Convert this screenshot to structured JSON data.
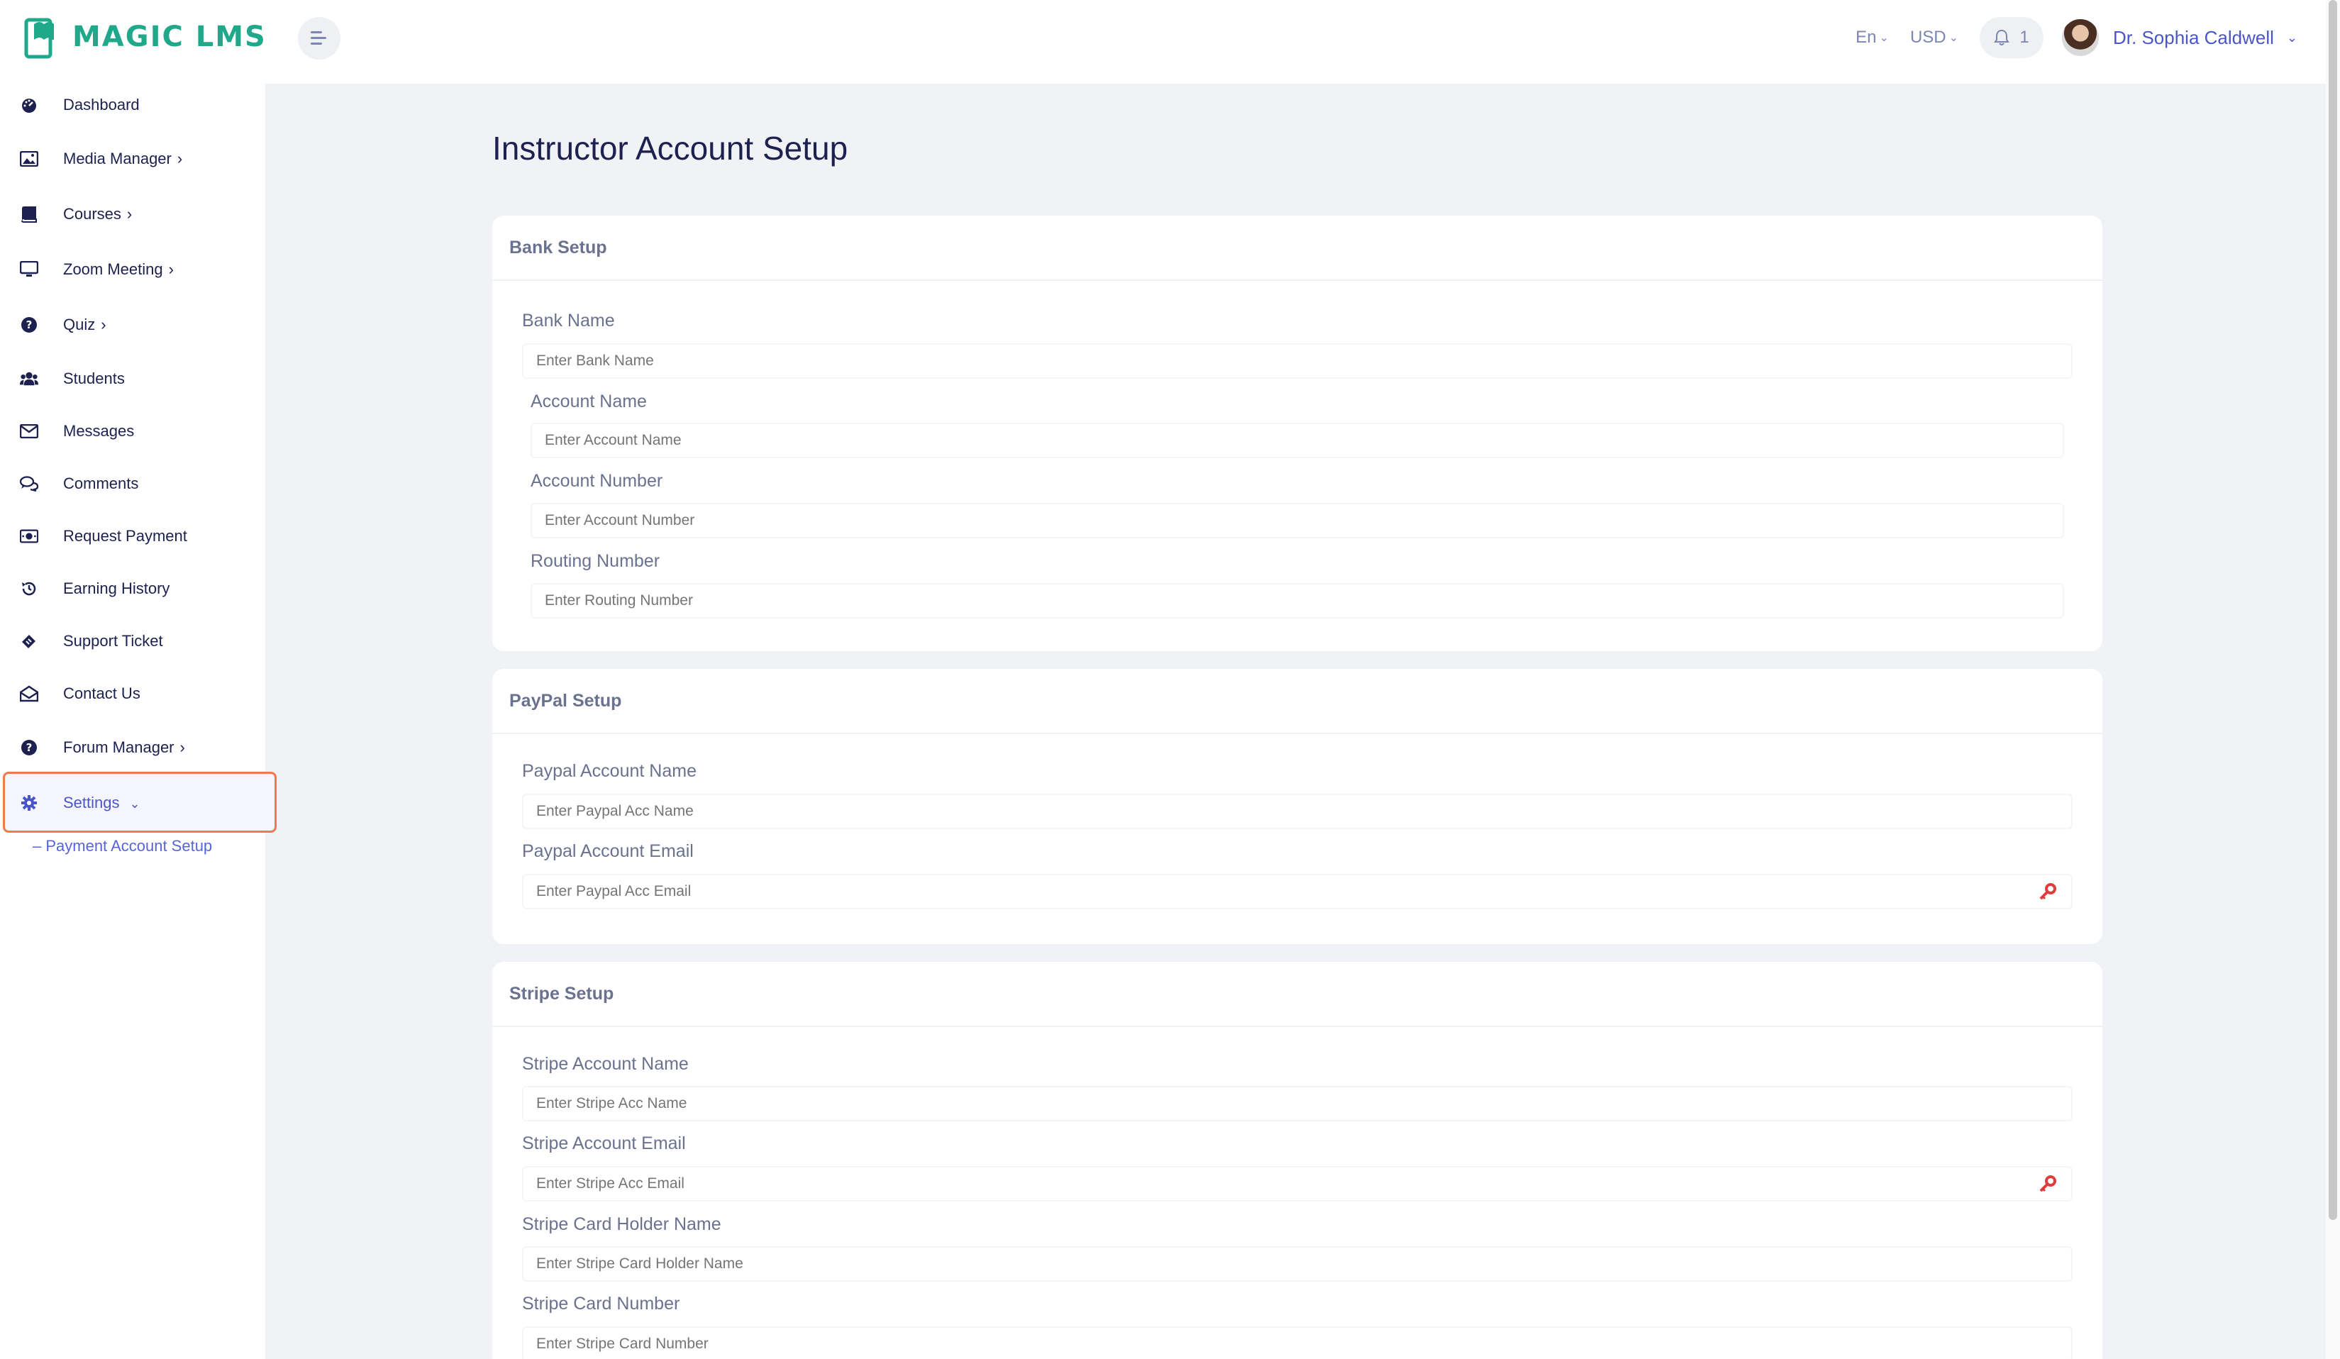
{
  "header": {
    "brand": "MAGIC LMS",
    "language": "En",
    "currency": "USD",
    "notification_count": "1",
    "user_name": "Dr. Sophia Caldwell"
  },
  "sidebar": {
    "items": [
      {
        "label": "Dashboard",
        "icon": "dashboard-icon"
      },
      {
        "label": "Media Manager",
        "icon": "image-icon"
      },
      {
        "label": "Courses",
        "icon": "book-icon"
      },
      {
        "label": "Zoom Meeting",
        "icon": "monitor-icon"
      },
      {
        "label": "Quiz",
        "icon": "question-icon"
      },
      {
        "label": "Students",
        "icon": "users-icon"
      },
      {
        "label": "Messages",
        "icon": "envelope-icon"
      },
      {
        "label": "Comments",
        "icon": "comments-icon"
      },
      {
        "label": "Request Payment",
        "icon": "money-icon"
      },
      {
        "label": "Earning History",
        "icon": "history-icon"
      },
      {
        "label": "Support Ticket",
        "icon": "ticket-icon"
      },
      {
        "label": "Contact Us",
        "icon": "envelope-open-icon"
      },
      {
        "label": "Forum Manager",
        "icon": "question-icon"
      },
      {
        "label": "Settings",
        "icon": "gear-icon"
      }
    ],
    "sub_item": "– Payment Account Setup"
  },
  "main": {
    "title": "Instructor Account Setup",
    "bank": {
      "heading": "Bank Setup",
      "bank_name_label": "Bank Name",
      "bank_name_placeholder": "Enter Bank Name",
      "account_name_label": "Account Name",
      "account_name_placeholder": "Enter Account Name",
      "account_number_label": "Account Number",
      "account_number_placeholder": "Enter Account Number",
      "routing_number_label": "Routing Number",
      "routing_number_placeholder": "Enter Routing Number"
    },
    "paypal": {
      "heading": "PayPal Setup",
      "acc_name_label": "Paypal Account Name",
      "acc_name_placeholder": "Enter Paypal Acc Name",
      "acc_email_label": "Paypal Account Email",
      "acc_email_placeholder": "Enter Paypal Acc Email"
    },
    "stripe": {
      "heading": "Stripe Setup",
      "acc_name_label": "Stripe Account Name",
      "acc_name_placeholder": "Enter Stripe Acc Name",
      "acc_email_label": "Stripe Account Email",
      "acc_email_placeholder": "Enter Stripe Acc Email",
      "holder_label": "Stripe Card Holder Name",
      "holder_placeholder": "Enter Stripe Card Holder Name",
      "card_number_label": "Stripe Card Number",
      "card_number_placeholder": "Enter Stripe Card Number"
    }
  },
  "colors": {
    "brand": "#1fa88a",
    "accent": "#4a56c8",
    "highlight_border": "#f07a4a",
    "key_icon": "#e23b3b"
  }
}
